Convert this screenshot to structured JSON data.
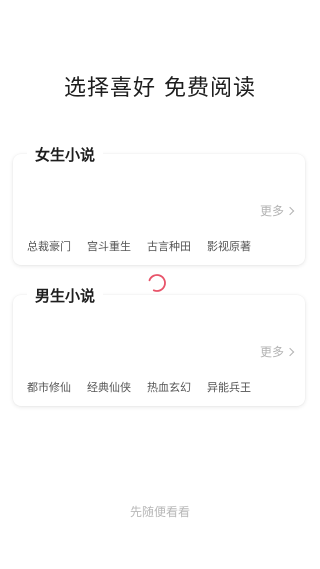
{
  "header": {
    "title": "选择喜好 免费阅读"
  },
  "female": {
    "label": "女生小说",
    "more_label": "更多",
    "tags": [
      "总裁豪门",
      "宫斗重生",
      "古言种田",
      "影视原著"
    ]
  },
  "male": {
    "label": "男生小说",
    "more_label": "更多",
    "tags": [
      "都市修仙",
      "经典仙侠",
      "热血玄幻",
      "异能兵王"
    ]
  },
  "footer": {
    "casual_label": "先随便看看"
  },
  "colors": {
    "spinner": "#e8546a",
    "muted_text": "#b3b3b3"
  },
  "icons": {
    "loading": "loading-spinner-icon",
    "more": "chevron-right-icon"
  }
}
